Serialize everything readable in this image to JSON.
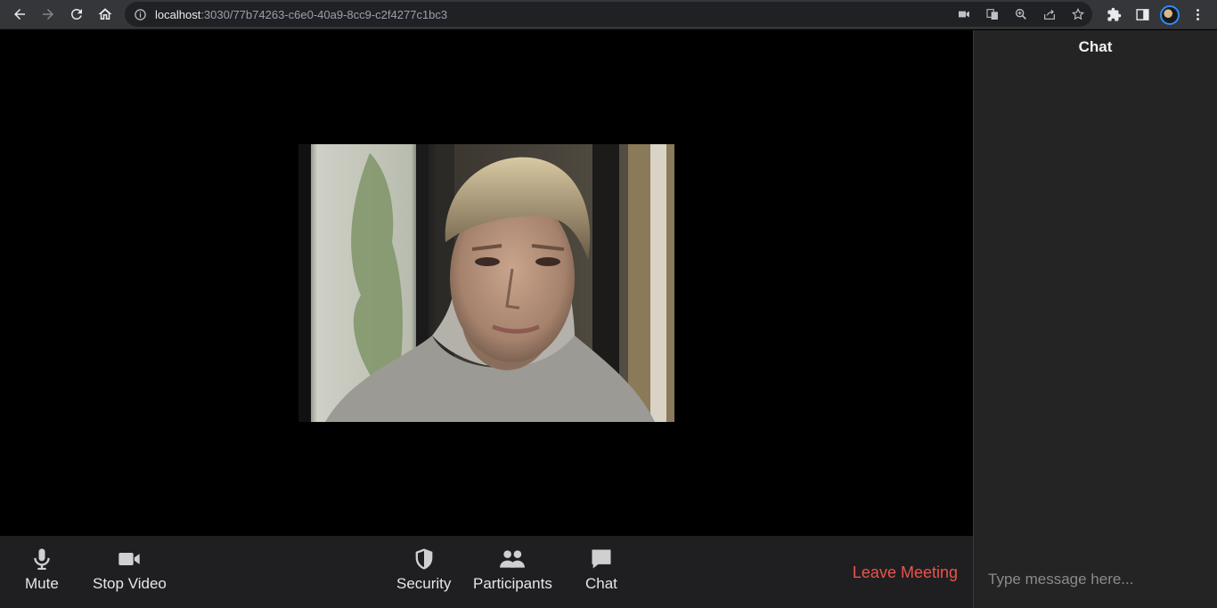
{
  "browser": {
    "url_host": "localhost",
    "url_rest": ":3030/77b74263-c6e0-40a9-8cc9-c2f4277c1bc3"
  },
  "controls": {
    "mute_label": "Mute",
    "stop_video_label": "Stop Video",
    "security_label": "Security",
    "participants_label": "Participants",
    "chat_label": "Chat",
    "leave_label": "Leave Meeting"
  },
  "chat": {
    "title": "Chat",
    "input_placeholder": "Type message here..."
  },
  "colors": {
    "leave": "#eb534b",
    "panel": "#242424",
    "toolbar": "#1f1f22"
  }
}
